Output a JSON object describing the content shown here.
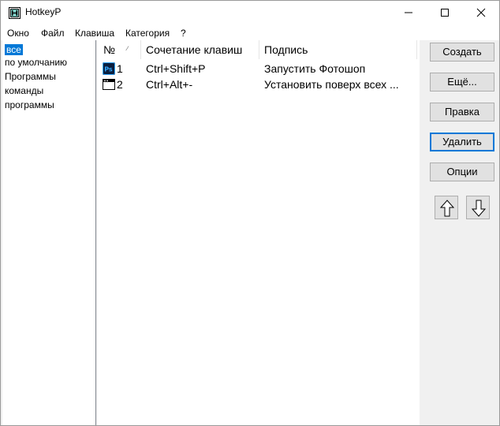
{
  "window": {
    "title": "HotkeyP",
    "controls": {
      "minimize": "minimize-icon",
      "maximize": "maximize-icon",
      "close": "close-icon"
    }
  },
  "menu": [
    "Окно",
    "Файл",
    "Клавиша",
    "Категория",
    "?"
  ],
  "categories": {
    "items": [
      "все",
      "по умолчанию",
      "Программы",
      "команды",
      "программы"
    ],
    "selected": "все"
  },
  "table": {
    "columns": [
      "№",
      "Сочетание клавиш",
      "Подпись"
    ],
    "sort_column": "№",
    "rows": [
      {
        "number": "1",
        "hotkey": "Ctrl+Shift+P",
        "caption": "Запустить Фотошоп",
        "icon": "photoshop-icon"
      },
      {
        "number": "2",
        "hotkey": "Ctrl+Alt+-",
        "caption": "Установить поверх всех ...",
        "icon": "window-icon"
      }
    ]
  },
  "buttons": {
    "create": "Создать",
    "more": "Ещё...",
    "edit": "Правка",
    "delete": "Удалить",
    "options": "Опции",
    "move_up": "arrow-up-icon",
    "move_down": "arrow-down-icon"
  },
  "colors": {
    "selection": "#0078d7",
    "default_button_border": "#0078d7",
    "photoshop_icon": "#0a1f3f"
  }
}
